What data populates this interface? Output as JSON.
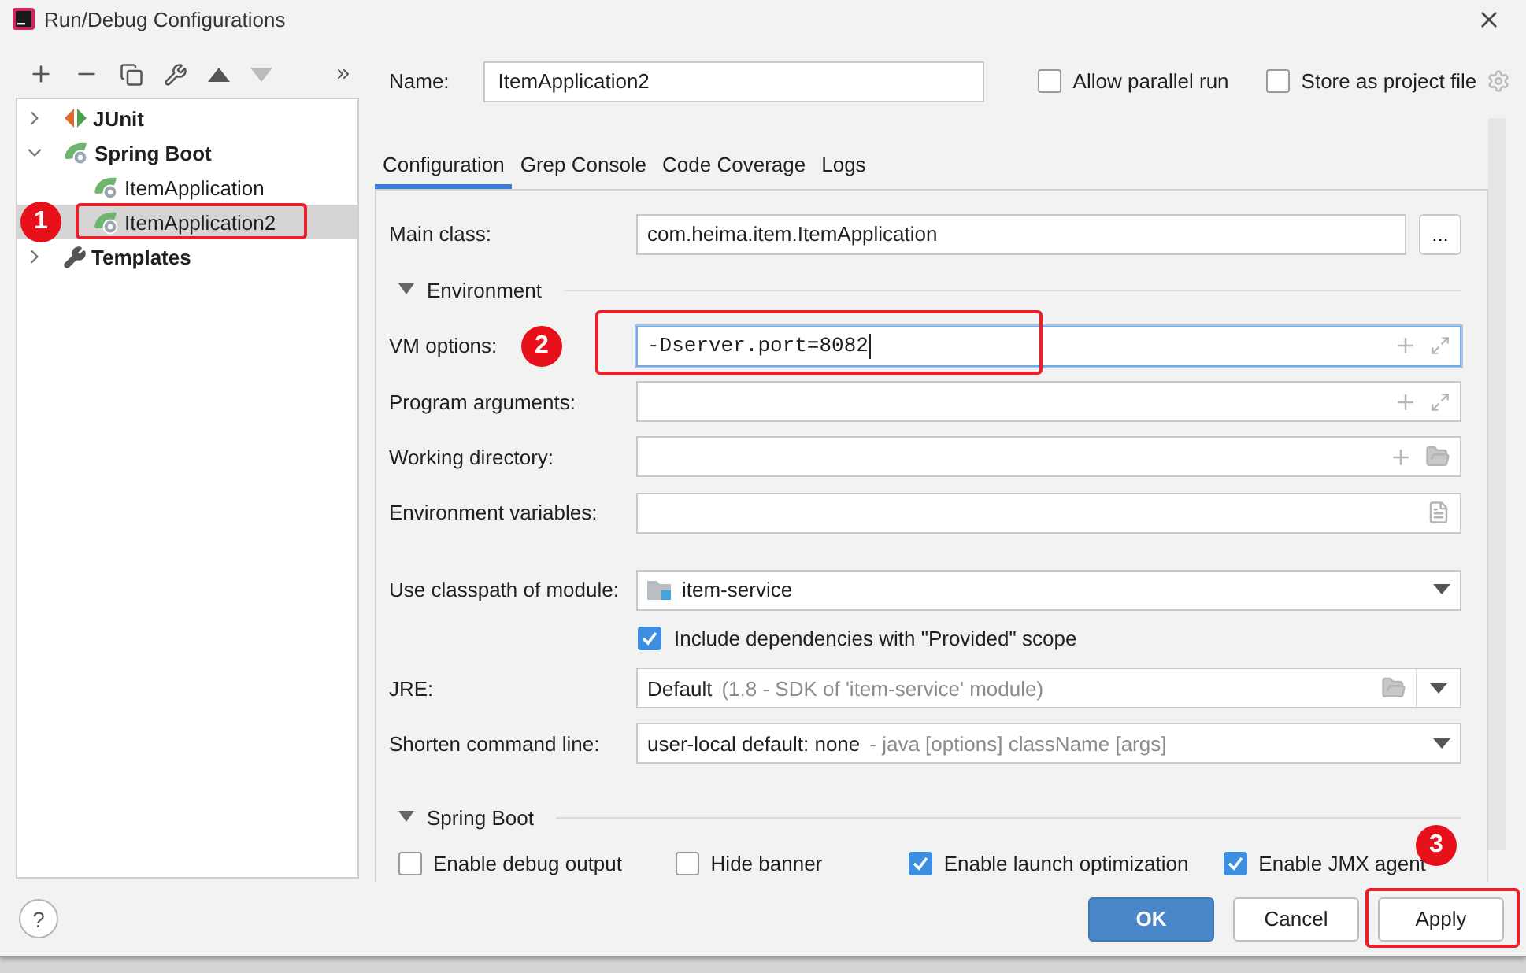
{
  "window": {
    "title": "Run/Debug Configurations"
  },
  "tree": [
    {
      "label": "JUnit",
      "kind": "junit",
      "expanded": false,
      "selected": false
    },
    {
      "label": "Spring Boot",
      "kind": "spring",
      "expanded": true,
      "selected": false,
      "children": [
        {
          "label": "ItemApplication",
          "kind": "spring-app",
          "selected": false
        },
        {
          "label": "ItemApplication2",
          "kind": "spring-app",
          "selected": true,
          "annotation": "1"
        }
      ]
    },
    {
      "label": "Templates",
      "kind": "template",
      "expanded": false,
      "selected": false
    }
  ],
  "name_field": {
    "label": "Name:",
    "value": "ItemApplication2"
  },
  "top_options": [
    {
      "label": "Allow parallel run",
      "checked": false
    },
    {
      "label": "Store as project file",
      "checked": false
    }
  ],
  "tabs": [
    {
      "label": "Configuration",
      "selected": true
    },
    {
      "label": "Grep Console",
      "selected": false
    },
    {
      "label": "Code Coverage",
      "selected": false
    },
    {
      "label": "Logs",
      "selected": false
    }
  ],
  "main_class": {
    "label": "Main class:",
    "value": "com.heima.item.ItemApplication",
    "button": "..."
  },
  "environment": {
    "title": "Environment",
    "expanded": true,
    "fields": [
      {
        "label": "VM options:",
        "value": "-Dserver.port=8082",
        "kind": "expand",
        "focused": true,
        "annotation": "2"
      },
      {
        "label": "Program arguments:",
        "kind": "expand",
        "focused": false
      },
      {
        "label": "Working directory:",
        "kind": "folder",
        "focused": false
      },
      {
        "label": "Environment variables:",
        "kind": "document",
        "focused": false
      }
    ]
  },
  "classpath": {
    "label": "Use classpath of module:",
    "value": "item-service"
  },
  "include_deps": {
    "label": "Include dependencies with \"Provided\" scope",
    "checked": true
  },
  "jre": {
    "label": "JRE:",
    "value": "Default",
    "hint": "(1.8 - SDK of 'item-service' module)"
  },
  "shorten": {
    "label": "Shorten command line:",
    "value": "user-local default: none",
    "hint": "- java [options] className [args]"
  },
  "spring_boot": {
    "title": "Spring Boot",
    "expanded": true,
    "options": [
      {
        "label": "Enable debug output",
        "checked": false
      },
      {
        "label": "Hide banner",
        "checked": false
      },
      {
        "label": "Enable launch optimization",
        "checked": true
      },
      {
        "label": "Enable JMX agent",
        "checked": true
      }
    ]
  },
  "help": "?",
  "buttons": [
    {
      "label": "OK",
      "kind": "primary"
    },
    {
      "label": "Cancel",
      "kind": "default"
    },
    {
      "label": "Apply",
      "kind": "default",
      "annotation": "3"
    }
  ]
}
